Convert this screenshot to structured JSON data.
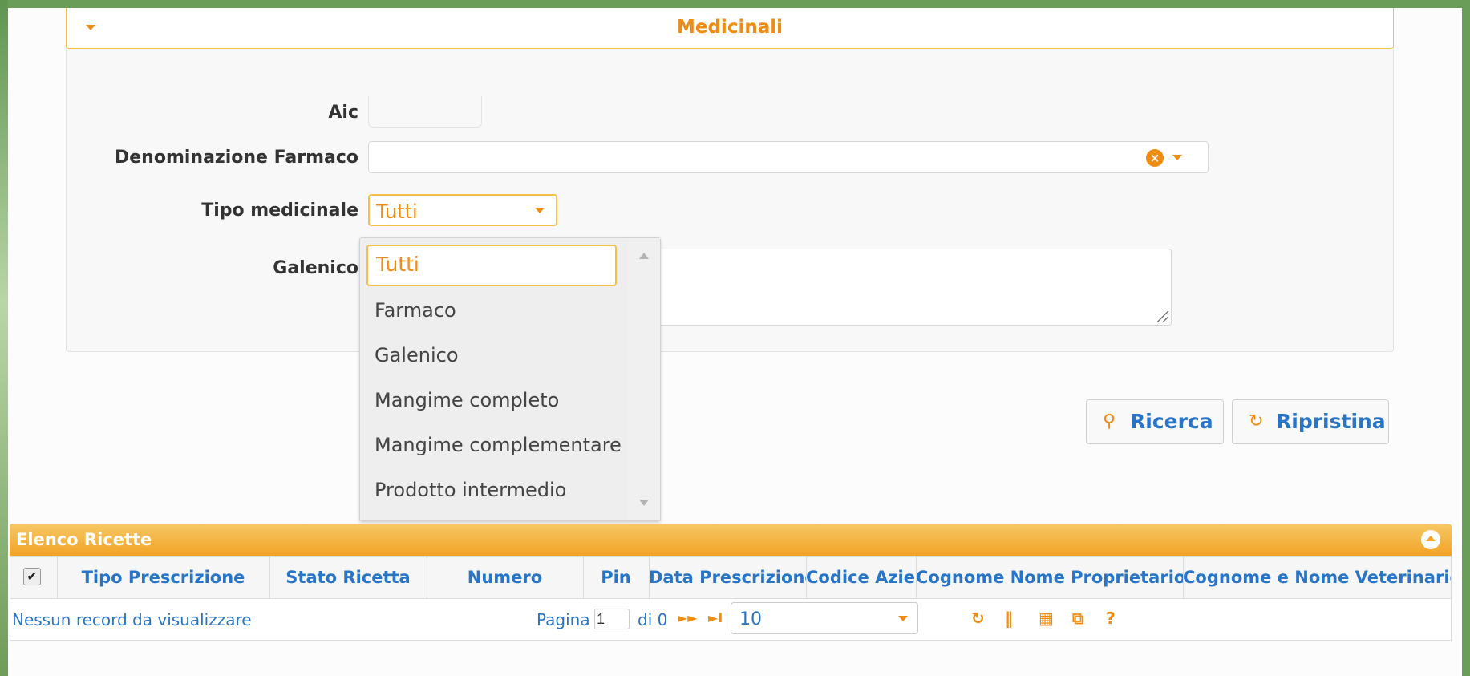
{
  "panel": {
    "title": "Medicinali",
    "fields": {
      "aic_label": "Aic",
      "aic_value": "",
      "denominazione_label": "Denominazione Farmaco",
      "denominazione_value": "",
      "tipo_label": "Tipo medicinale",
      "tipo_value": "Tutti",
      "galenico_label": "Galenico",
      "galenico_value": ""
    }
  },
  "dropdown": {
    "options": [
      "Tutti",
      "Farmaco",
      "Galenico",
      "Mangime completo",
      "Mangime complementare",
      "Prodotto intermedio"
    ],
    "selected": "Tutti"
  },
  "buttons": {
    "search_label": "Ricerca",
    "reset_label": "Ripristina"
  },
  "grid": {
    "title": "Elenco Ricette",
    "columns": [
      "Tipo Prescrizione",
      "Stato Ricetta",
      "Numero",
      "Pin",
      "Data Prescrizione",
      "Codice Aziei",
      "Cognome Nome Proprietario",
      "Cognome e Nome Veterinario"
    ],
    "checkbox_mark": "✔",
    "empty_message": "Nessun record da visualizzare",
    "pager": {
      "page_label": "Pagina",
      "page_value": "1",
      "of_label": "di 0",
      "next_icon": "►►",
      "last_icon": "►I",
      "rows_per_page": "10"
    },
    "tools": [
      "refresh-icon",
      "columns-icon",
      "grid-icon",
      "popout-icon",
      "help-icon"
    ],
    "help_glyph": "?"
  },
  "colors": {
    "accent": "#f08c12",
    "link": "#2874c6",
    "frame": "#6a9e58"
  }
}
